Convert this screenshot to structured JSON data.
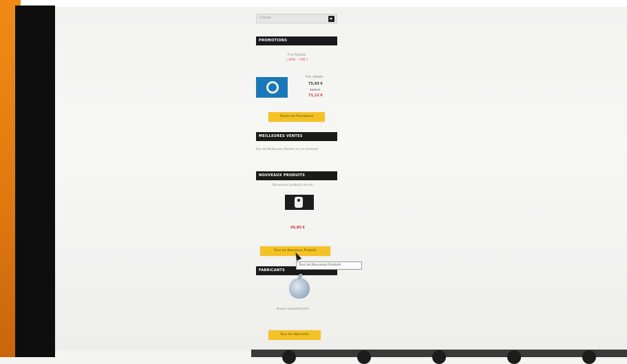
{
  "select": {
    "placeholder": "Choisir..."
  },
  "blocks": {
    "promotions": {
      "title": "PROMOTIONS",
      "intro_line1": "Prix Réduits",
      "intro_line2": "(-20% · -75€ )",
      "product": {
        "price_label": "Prix réduits",
        "price": "75,93 €",
        "old_price": "94,91 €",
        "new_price": "71,12 €"
      },
      "button": "Toutes les Promotions"
    },
    "bestsellers": {
      "title": "MEILLEURES VENTES",
      "empty_text": "Pas de Meilleures Ventes en ce moment"
    },
    "new_products": {
      "title": "NOUVEAUX PRODUITS",
      "intro": "Nouveaux produits mis en...",
      "price": "26,85 €",
      "button": "Tous les Nouveaux Produits",
      "tooltip": "Tous les Nouveaux Produits"
    },
    "manufacturers": {
      "title": "FABRICANTS",
      "caption": "Aucun manufacturier",
      "button": "Tous les fabricants"
    }
  },
  "colors": {
    "accent_yellow": "#f4c224",
    "title_bar": "#1a1a1a",
    "price_red": "#d03030",
    "bezel_orange": "#f08a16"
  },
  "icons": {
    "select_dropdown": "chevron-down-icon",
    "cursor": "mouse-cursor-icon",
    "manufacturer_logo": "apple-logo"
  }
}
